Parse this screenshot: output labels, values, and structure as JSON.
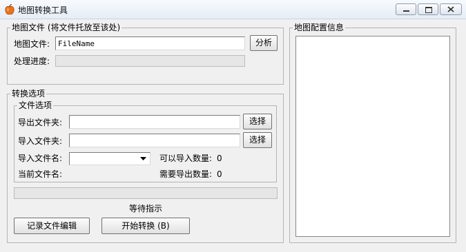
{
  "window": {
    "title": "地图转换工具"
  },
  "file_group": {
    "legend": "地图文件 (将文件托放至该处)",
    "map_file_label": "地图文件:",
    "map_file_value": "FileName",
    "analyze_button": "分析",
    "progress_label": "处理进度:",
    "progress_value": 0
  },
  "options_group": {
    "legend": "转换选项",
    "file_options_legend": "文件选项",
    "export_folder_label": "导出文件夹:",
    "export_folder_value": "",
    "export_select_button": "选择",
    "import_folder_label": "导入文件夹:",
    "import_folder_value": "",
    "import_select_button": "选择",
    "import_filename_label": "导入文件名:",
    "import_filename_value": "",
    "importable_count_label": "可以导入数量:",
    "importable_count_value": "0",
    "current_file_label": "当前文件名:",
    "current_file_value": "",
    "export_needed_label": "需要导出数量:",
    "export_needed_value": "0",
    "progress_value": 0,
    "status_text": "等待指示",
    "record_edit_button": "记录文件编辑",
    "start_convert_button": "开始转换 (B)"
  },
  "config_group": {
    "legend": "地图配置信息",
    "content": ""
  }
}
